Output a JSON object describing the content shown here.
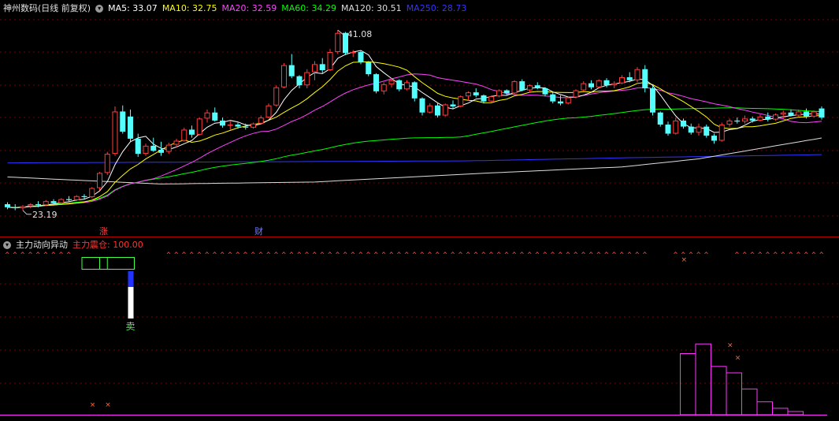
{
  "upper_header": {
    "title": "神州数码(日线 前复权)",
    "collapse_icon": "chevron-down-icon",
    "ma": [
      {
        "label": "MA5: 33.07",
        "color": "#ffffff"
      },
      {
        "label": "MA10: 32.75",
        "color": "#ffff00"
      },
      {
        "label": "MA20: 32.59",
        "color": "#ff44ff"
      },
      {
        "label": "MA60: 34.29",
        "color": "#00ff00"
      },
      {
        "label": "MA120: 30.51",
        "color": "#dddddd"
      },
      {
        "label": "MA250: 28.73",
        "color": "#3333ff"
      }
    ]
  },
  "lower_header": {
    "title": "主力动向异动",
    "indicator": "主力震仓: 100.00",
    "indicator_color": "#ff3333"
  },
  "annotations": {
    "high_label": "41.08",
    "low_label": "23.19",
    "event_zhang": "涨",
    "event_cai": "财",
    "sell_label": "卖"
  },
  "colors": {
    "up": "#ff3b3b",
    "down": "#54ffff",
    "ma5": "#ffffff",
    "ma10": "#ffff00",
    "ma20": "#ff44ff",
    "ma60": "#00ff00",
    "ma120": "#dddddd",
    "ma250": "#3333ff",
    "grid": "#7a0000"
  },
  "chart_data": {
    "type": "candlestick",
    "price_axis": [
      22,
      42.5
    ],
    "ohlc": [
      [
        23.8,
        24.0,
        23.3,
        23.5
      ],
      [
        23.5,
        23.8,
        23.2,
        23.4
      ],
      [
        23.4,
        23.7,
        23.19,
        23.6
      ],
      [
        23.6,
        23.9,
        23.4,
        23.8
      ],
      [
        23.8,
        24.1,
        23.5,
        23.7
      ],
      [
        23.7,
        24.2,
        23.6,
        24.1
      ],
      [
        24.1,
        24.3,
        23.8,
        23.9
      ],
      [
        23.9,
        24.4,
        23.8,
        24.3
      ],
      [
        24.3,
        24.6,
        24.0,
        24.2
      ],
      [
        24.2,
        24.7,
        24.1,
        24.6
      ],
      [
        24.6,
        24.8,
        24.3,
        24.5
      ],
      [
        24.5,
        25.5,
        24.4,
        25.4
      ],
      [
        25.4,
        27.0,
        25.2,
        26.9
      ],
      [
        26.9,
        29.0,
        26.7,
        28.8
      ],
      [
        28.8,
        33.5,
        28.6,
        33.0
      ],
      [
        33.0,
        33.6,
        30.8,
        31.0
      ],
      [
        32.5,
        33.2,
        30.0,
        30.3
      ],
      [
        30.3,
        30.8,
        28.5,
        28.8
      ],
      [
        28.8,
        29.8,
        28.6,
        29.6
      ],
      [
        29.6,
        30.4,
        29.0,
        29.1
      ],
      [
        29.2,
        30.0,
        28.6,
        28.9
      ],
      [
        29.0,
        29.9,
        28.8,
        29.7
      ],
      [
        29.7,
        30.3,
        29.4,
        30.1
      ],
      [
        30.1,
        31.4,
        30.0,
        31.2
      ],
      [
        31.2,
        31.6,
        30.4,
        30.7
      ],
      [
        30.7,
        32.4,
        30.6,
        32.3
      ],
      [
        32.3,
        33.2,
        31.9,
        32.9
      ],
      [
        32.9,
        33.4,
        32.0,
        32.1
      ],
      [
        32.1,
        32.4,
        31.4,
        31.6
      ],
      [
        31.6,
        32.1,
        31.2,
        31.7
      ],
      [
        31.7,
        31.9,
        31.3,
        31.5
      ],
      [
        31.5,
        31.8,
        31.2,
        31.4
      ],
      [
        31.4,
        31.9,
        31.3,
        31.8
      ],
      [
        31.8,
        32.6,
        31.7,
        32.4
      ],
      [
        32.4,
        33.8,
        32.3,
        33.6
      ],
      [
        33.6,
        35.6,
        33.5,
        35.4
      ],
      [
        35.4,
        37.8,
        35.3,
        37.6
      ],
      [
        37.6,
        38.7,
        36.3,
        36.5
      ],
      [
        36.5,
        36.6,
        35.3,
        35.6
      ],
      [
        35.6,
        37.2,
        35.3,
        36.9
      ],
      [
        36.9,
        38.0,
        36.1,
        37.7
      ],
      [
        37.7,
        38.3,
        36.8,
        37.1
      ],
      [
        37.1,
        39.2,
        37.0,
        38.9
      ],
      [
        38.9,
        41.08,
        38.7,
        40.8
      ],
      [
        40.8,
        40.9,
        38.6,
        38.8
      ],
      [
        38.8,
        39.1,
        38.4,
        38.9
      ],
      [
        38.9,
        39.0,
        37.7,
        37.9
      ],
      [
        37.9,
        38.0,
        36.5,
        36.7
      ],
      [
        36.7,
        36.8,
        34.8,
        35.0
      ],
      [
        35.0,
        35.9,
        34.7,
        35.7
      ],
      [
        35.7,
        36.3,
        35.4,
        36.1
      ],
      [
        36.1,
        36.2,
        35.0,
        35.2
      ],
      [
        35.2,
        36.1,
        35.1,
        35.9
      ],
      [
        35.9,
        36.0,
        34.0,
        34.3
      ],
      [
        34.3,
        34.4,
        32.6,
        32.9
      ],
      [
        32.9,
        33.8,
        32.8,
        33.6
      ],
      [
        33.6,
        33.9,
        32.4,
        32.6
      ],
      [
        32.6,
        33.8,
        32.5,
        33.7
      ],
      [
        33.7,
        34.1,
        33.3,
        33.5
      ],
      [
        33.5,
        34.6,
        33.4,
        34.5
      ],
      [
        34.5,
        35.0,
        34.1,
        34.9
      ],
      [
        34.9,
        35.3,
        34.4,
        34.6
      ],
      [
        34.6,
        34.7,
        33.8,
        34.0
      ],
      [
        34.0,
        34.6,
        33.9,
        34.5
      ],
      [
        34.5,
        35.2,
        34.4,
        35.1
      ],
      [
        35.1,
        35.2,
        34.6,
        34.8
      ],
      [
        34.8,
        36.1,
        34.7,
        36.0
      ],
      [
        36.0,
        36.2,
        35.0,
        35.1
      ],
      [
        35.1,
        35.7,
        34.9,
        35.6
      ],
      [
        35.6,
        35.9,
        35.2,
        35.3
      ],
      [
        35.3,
        35.4,
        34.5,
        34.7
      ],
      [
        34.7,
        34.9,
        33.8,
        34.0
      ],
      [
        34.0,
        34.6,
        33.6,
        33.8
      ],
      [
        33.8,
        34.5,
        33.7,
        34.4
      ],
      [
        34.4,
        35.2,
        34.3,
        35.1
      ],
      [
        35.1,
        36.0,
        35.0,
        35.8
      ],
      [
        35.8,
        36.1,
        35.2,
        35.4
      ],
      [
        35.4,
        36.2,
        35.3,
        36.1
      ],
      [
        36.1,
        36.3,
        35.4,
        35.6
      ],
      [
        35.6,
        36.0,
        35.3,
        35.8
      ],
      [
        35.8,
        36.6,
        35.7,
        36.4
      ],
      [
        36.4,
        36.9,
        35.9,
        36.1
      ],
      [
        36.1,
        37.4,
        35.9,
        37.2
      ],
      [
        37.2,
        37.6,
        34.9,
        35.3
      ],
      [
        35.3,
        35.5,
        32.6,
        32.9
      ],
      [
        32.9,
        33.0,
        31.5,
        31.7
      ],
      [
        31.7,
        32.0,
        30.6,
        30.8
      ],
      [
        30.8,
        32.4,
        30.7,
        32.1
      ],
      [
        32.1,
        32.3,
        31.3,
        31.5
      ],
      [
        31.5,
        31.8,
        30.7,
        30.9
      ],
      [
        30.9,
        31.8,
        30.6,
        31.5
      ],
      [
        31.5,
        31.7,
        30.4,
        30.6
      ],
      [
        30.6,
        30.8,
        29.8,
        30.1
      ],
      [
        30.1,
        31.9,
        30.0,
        31.7
      ],
      [
        31.7,
        32.3,
        31.5,
        32.1
      ],
      [
        32.1,
        32.4,
        31.8,
        32.0
      ],
      [
        32.0,
        32.6,
        31.8,
        32.3
      ],
      [
        32.3,
        32.5,
        31.9,
        32.1
      ],
      [
        32.1,
        32.7,
        32.0,
        32.5
      ],
      [
        32.5,
        32.9,
        32.0,
        32.2
      ],
      [
        32.2,
        32.8,
        32.1,
        32.7
      ],
      [
        32.7,
        33.1,
        32.3,
        32.9
      ],
      [
        32.9,
        33.2,
        32.5,
        32.6
      ],
      [
        32.6,
        33.2,
        32.5,
        33.0
      ],
      [
        33.0,
        33.3,
        32.3,
        32.5
      ],
      [
        32.5,
        33.1,
        32.4,
        33.0
      ],
      [
        33.3,
        33.5,
        32.2,
        32.4
      ]
    ],
    "ma120_points": [
      [
        0,
        26.5
      ],
      [
        20,
        25.8
      ],
      [
        40,
        26.0
      ],
      [
        60,
        26.8
      ],
      [
        80,
        27.5
      ],
      [
        90,
        28.3
      ],
      [
        107,
        30.5
      ]
    ],
    "ma250_points": [
      [
        0,
        27.9
      ],
      [
        30,
        28.0
      ],
      [
        60,
        28.1
      ],
      [
        80,
        28.4
      ],
      [
        107,
        28.73
      ]
    ],
    "lower_panel": {
      "type": "bar",
      "signal_box_index": 16,
      "sell_index": 16,
      "x_marks": [
        [
          11,
          0.05
        ],
        [
          13,
          0.05
        ],
        [
          88,
          0.95
        ],
        [
          94,
          0.42
        ],
        [
          95,
          0.34
        ]
      ],
      "histogram": [
        {
          "i": 88,
          "v": 0.38
        },
        {
          "i": 90,
          "v": 0.44
        },
        {
          "i": 92,
          "v": 0.3
        },
        {
          "i": 94,
          "v": 0.26
        },
        {
          "i": 96,
          "v": 0.16
        },
        {
          "i": 98,
          "v": 0.08
        },
        {
          "i": 100,
          "v": 0.04
        },
        {
          "i": 102,
          "v": 0.02
        }
      ]
    }
  }
}
